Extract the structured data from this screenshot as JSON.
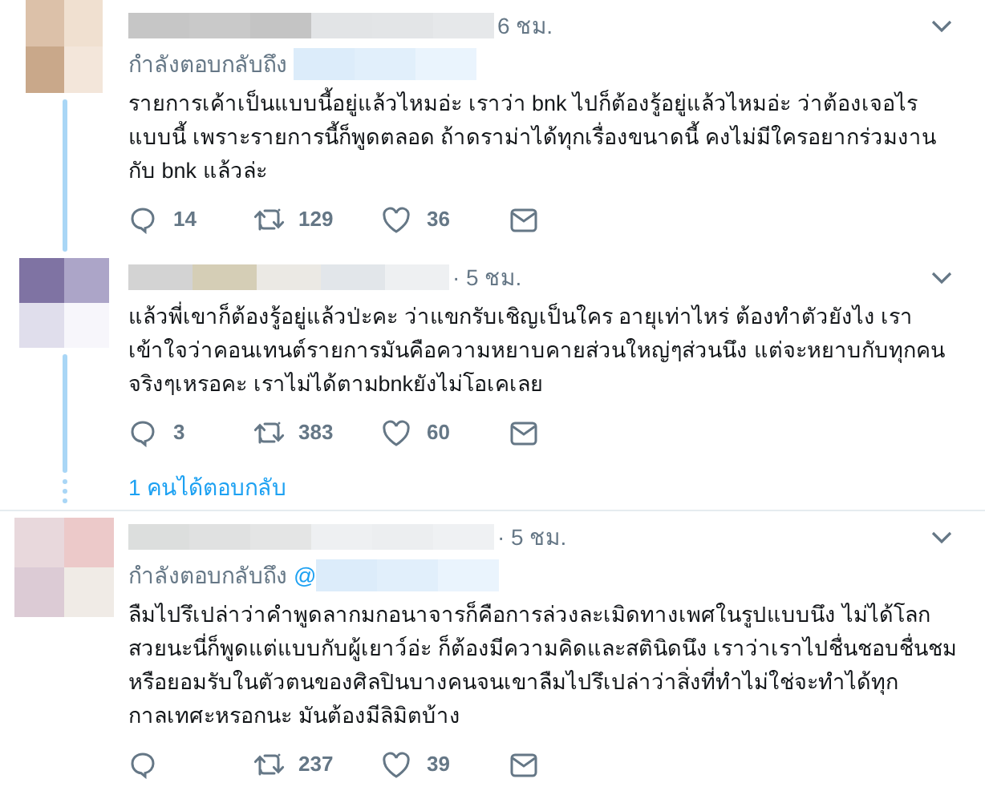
{
  "tweets": [
    {
      "time": "6 ชม.",
      "reply_to": {
        "label": "กำลังตอบกลับถึง"
      },
      "body": "รายการเค้าเป็นแบบนี้อยู่แล้วไหมอ่ะ เราว่า bnk ไปก็ต้องรู้อยู่แล้วไหมอ่ะ ว่าต้องเจอไรแบบนี้ เพราะรายการนี้ก็พูดตลอด ถ้าดราม่าได้ทุกเรื่องขนาดนี้ คงไม่มีใครอยากร่วมงานกับ bnk แล้วล่ะ",
      "replies": "14",
      "retweets": "129",
      "likes": "36",
      "thread": true
    },
    {
      "time": "· 5 ชม.",
      "body": "แล้วพี่เขาก็ต้องรู้อยู่แล้วป่ะคะ ว่าแขกรับเชิญเป็นใคร อายุเท่าไหร่ ต้องทำตัวยังไง เราเข้าใจว่าคอนเทนต์รายการมันคือความหยาบคายส่วนใหญ่ๆส่วนนึง แต่จะหยาบกับทุกคนจริงๆเหรอคะ เราไม่ได้ตามbnkยังไม่โอเคเลย",
      "replies": "3",
      "retweets": "383",
      "likes": "60",
      "thread": true,
      "more_replies": "1 คนได้ตอบกลับ"
    },
    {
      "time": "· 5 ชม.",
      "reply_to": {
        "label": "กำลังตอบกลับถึง",
        "prefix": "@"
      },
      "body": "ลืมไปรึเปล่าว่าคำพูดลากมกอนาจารก็คือการล่วงละเมิดทางเพศในรูปแบบนึง ไม่ได้โลกสวยนะนี่ก็พูดแต่แบบกับผู้เยาว์อ่ะ ก็ต้องมีความคิดและสตินิดนึง เราว่าเราไปชื่นชอบชื่นชมหรือยอมรับในตัวตนของศิลปินบางคนจนเขาลืมไปรึเปล่าว่าสิ่งที่ทำไม่ใช่จะทำได้ทุกกาลเทศะหรอกนะ มันต้องมีลิมิตบ้าง",
      "retweets": "237",
      "likes": "39",
      "thread": false
    }
  ]
}
